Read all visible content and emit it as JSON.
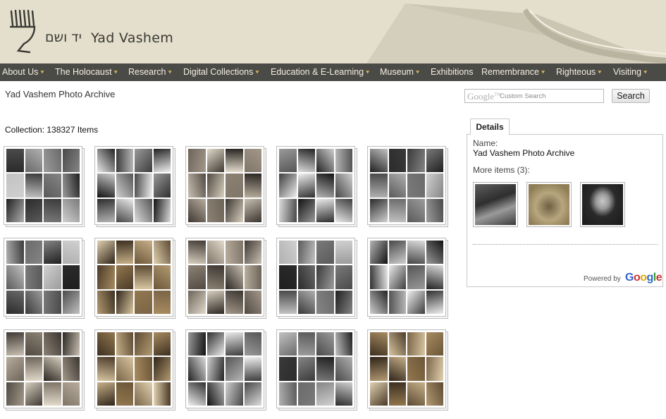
{
  "header": {
    "logo_hebrew": "יד ושם",
    "logo_english": "Yad Vashem",
    "colors": {
      "header_bg": "#e3dfcc",
      "nav_bg": "#4a4a46",
      "nav_chevron": "#d6b25c"
    }
  },
  "nav": {
    "items": [
      {
        "label": "About Us",
        "chevron": "chevron-down-icon"
      },
      {
        "label": "The Holocaust",
        "chevron": "chevron-down-icon"
      },
      {
        "label": "Research",
        "chevron": "chevron-down-icon"
      },
      {
        "label": "Digital Collections",
        "chevron": "chevron-down-icon"
      },
      {
        "label": "Education & E-Learning",
        "chevron": "chevron-down-icon"
      },
      {
        "label": "Museum",
        "chevron": "chevron-down-icon"
      },
      {
        "label": "Exhibitions"
      },
      {
        "label": "Remembrance",
        "chevron": "chevron-down-icon"
      },
      {
        "label": "Righteous",
        "chevron": "chevron-down-icon"
      },
      {
        "label": "Visiting",
        "chevron": "chevron-down-icon"
      }
    ]
  },
  "page": {
    "title": "Yad Vashem Photo Archive",
    "collection": "Collection: 138327 Items"
  },
  "search": {
    "google_mark": "Google",
    "placeholder": "Custom Search",
    "button": "Search"
  },
  "details": {
    "tab": "Details",
    "name_label": "Name:",
    "name_value": "Yad Vashem Photo Archive",
    "more_items": "More items (3):",
    "thumbnails": [
      {
        "icon": "photo-thumbnail",
        "tone": "gray"
      },
      {
        "icon": "photo-thumbnail",
        "tone": "sepia"
      },
      {
        "icon": "photo-thumbnail",
        "tone": "portrait"
      }
    ],
    "powered_by": "Powered by",
    "google_logo": "Google"
  },
  "collage": {
    "tiles": [
      {
        "tone": "gray"
      },
      {
        "tone": "bw"
      },
      {
        "tone": "warm"
      },
      {
        "tone": "bw"
      },
      {
        "tone": "gray"
      },
      {
        "tone": "gray"
      },
      {
        "tone": "sepia"
      },
      {
        "tone": "warm"
      },
      {
        "tone": "gray"
      },
      {
        "tone": "bw"
      },
      {
        "tone": "warm"
      },
      {
        "tone": "sepia"
      },
      {
        "tone": "bw"
      },
      {
        "tone": "gray"
      },
      {
        "tone": "sepia"
      }
    ]
  }
}
